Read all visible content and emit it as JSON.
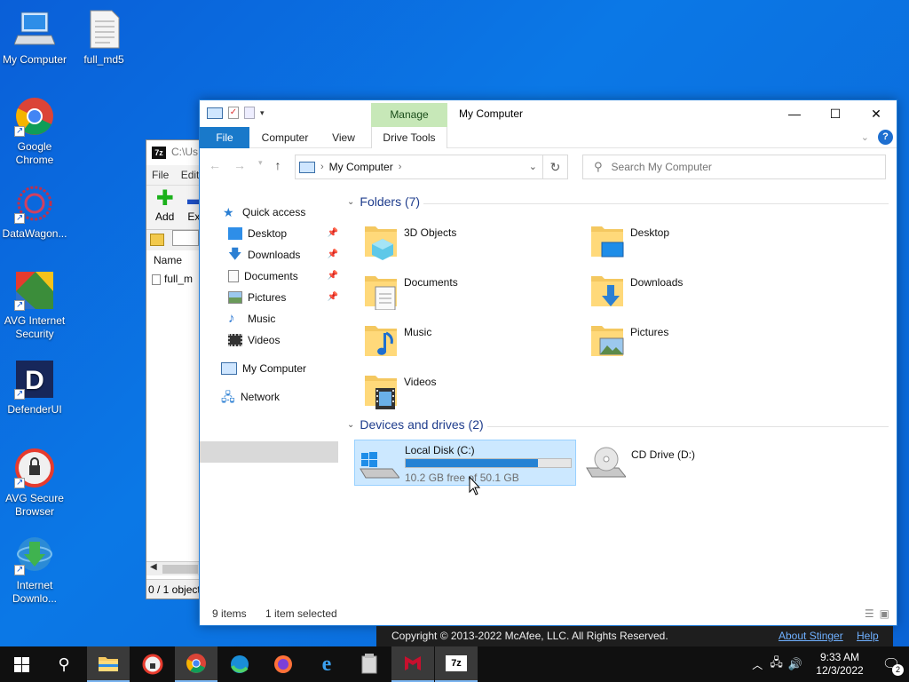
{
  "desktop": {
    "icons": [
      {
        "label": "My Computer",
        "icon": "computer-icon"
      },
      {
        "label": "full_md5",
        "icon": "text-file-icon"
      },
      {
        "label": "Google Chrome",
        "icon": "chrome-icon"
      },
      {
        "label": "DataWagon...",
        "icon": "datawagon-icon"
      },
      {
        "label": "AVG Internet Security",
        "icon": "avg-icon"
      },
      {
        "label": "DefenderUI",
        "icon": "defenderui-icon"
      },
      {
        "label": "AVG Secure Browser",
        "icon": "avg-browser-icon"
      },
      {
        "label": "Internet Downlo...",
        "icon": "idm-icon"
      }
    ]
  },
  "sevenzip": {
    "title": "C:\\Us",
    "menu": [
      "File",
      "Edit"
    ],
    "tools": [
      "Add",
      "Ext"
    ],
    "column_name": "Name",
    "row": "full_m",
    "status": "0 / 1 object"
  },
  "explorer": {
    "manage_tab": "Manage",
    "title": "My Computer",
    "tabs": {
      "file": "File",
      "computer": "Computer",
      "view": "View",
      "drive_tools": "Drive Tools"
    },
    "address": "My Computer",
    "search_placeholder": "Search My Computer",
    "nav": {
      "quick_access": "Quick access",
      "desktop": "Desktop",
      "downloads": "Downloads",
      "documents": "Documents",
      "pictures": "Pictures",
      "music": "Music",
      "videos": "Videos",
      "my_computer": "My Computer",
      "network": "Network"
    },
    "folders_header": "Folders (7)",
    "folders": {
      "objects3d": "3D Objects",
      "desktop": "Desktop",
      "documents": "Documents",
      "downloads": "Downloads",
      "music": "Music",
      "pictures": "Pictures",
      "videos": "Videos"
    },
    "devices_header": "Devices and drives (2)",
    "drives": {
      "c_name": "Local Disk (C:)",
      "c_free": "10.2 GB free of 50.1 GB",
      "c_used_fraction": 0.8,
      "d_name": "CD Drive (D:)"
    },
    "status": {
      "items": "9 items",
      "selected": "1 item selected"
    }
  },
  "mcafee": {
    "copyright": "Copyright © 2013-2022 McAfee, LLC. All Rights Reserved.",
    "about": "About Stinger",
    "help": "Help"
  },
  "taskbar": {
    "time": "9:33 AM",
    "date": "12/3/2022",
    "notifications": "2"
  },
  "colors": {
    "accent": "#1979ca",
    "manage": "#c7e8b8",
    "selection": "#cce8ff",
    "desktop": "#0b78e6"
  }
}
